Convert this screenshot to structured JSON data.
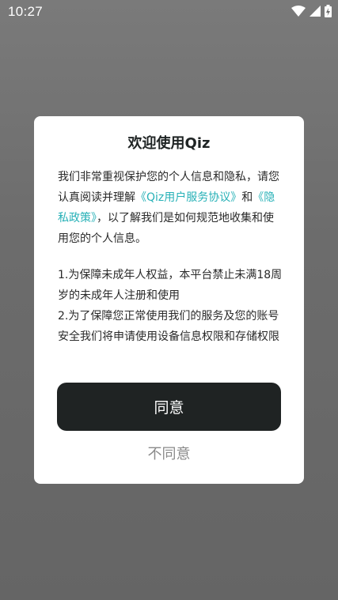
{
  "status_bar": {
    "time": "10:27",
    "icons": [
      "wifi-icon",
      "signal-icon",
      "battery-charging-icon"
    ]
  },
  "dialog": {
    "title": "欢迎使用Qiz",
    "intro_before": "我们非常重视保护您的个人信息和隐私，请您认真阅读并理解",
    "user_agreement_link": "《Qiz用户服务协议》",
    "intro_and": "和",
    "privacy_policy_link": "《隐私政策》",
    "intro_after": "，以了解我们是如何规范地收集和使用您的个人信息。",
    "rules": [
      "1.为保障未成年人权益，本平台禁止未满18周岁的未成年人注册和使用",
      "2.为了保障您正常使用我们的服务及您的账号安全我们将申请使用设备信息权限和存储权限"
    ],
    "agree_label": "同意",
    "disagree_label": "不同意"
  },
  "colors": {
    "overlay": "#6b6b6b",
    "dialog_bg": "#ffffff",
    "link": "#27b1b7",
    "primary_button": "#1f2323",
    "secondary_text": "#8a8a8a"
  }
}
